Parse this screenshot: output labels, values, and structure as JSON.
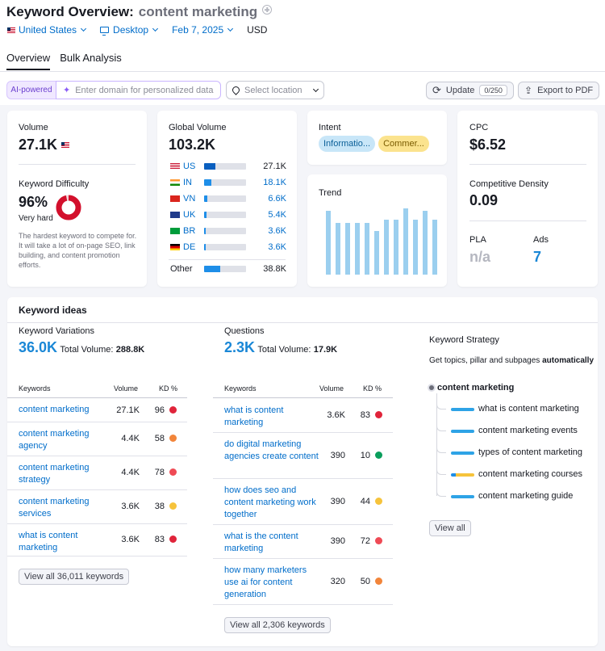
{
  "header": {
    "title_prefix": "Keyword Overview:",
    "keyword": "content marketing",
    "country": "United States",
    "device": "Desktop",
    "date": "Feb 7, 2025",
    "currency": "USD"
  },
  "tabs": [
    "Overview",
    "Bulk Analysis"
  ],
  "toolbar": {
    "ai_label": "AI-powered",
    "domain_placeholder": "Enter domain for personalized data",
    "location_placeholder": "Select location",
    "update_label": "Update",
    "update_badge": "0/250",
    "export_label": "Export to PDF"
  },
  "volume": {
    "label": "Volume",
    "value": "27.1K",
    "kd_label": "Keyword Difficulty",
    "kd_value": "96%",
    "kd_percent": 96,
    "kd_text": "Very hard",
    "kd_desc": "The hardest keyword to compete for. It will take a lot of on-page SEO, link building, and content promotion efforts."
  },
  "global": {
    "label": "Global Volume",
    "value": "103.2K",
    "rows": [
      {
        "code": "US",
        "value": "27.1K",
        "share": 0.26
      },
      {
        "code": "IN",
        "value": "18.1K",
        "share": 0.18
      },
      {
        "code": "VN",
        "value": "6.6K",
        "share": 0.07
      },
      {
        "code": "UK",
        "value": "5.4K",
        "share": 0.06
      },
      {
        "code": "BR",
        "value": "3.6K",
        "share": 0.04
      },
      {
        "code": "DE",
        "value": "3.6K",
        "share": 0.04
      }
    ],
    "other_label": "Other",
    "other_value": "38.8K",
    "other_share": 0.38
  },
  "intent": {
    "label": "Intent",
    "tags": [
      "Informatio...",
      "Commer..."
    ]
  },
  "trend": {
    "label": "Trend",
    "values": [
      0.96,
      0.78,
      0.78,
      0.78,
      0.78,
      0.66,
      0.83,
      0.83,
      1.0,
      0.83,
      0.96,
      0.83
    ]
  },
  "cpc": {
    "label": "CPC",
    "value": "$6.52",
    "cd_label": "Competitive Density",
    "cd_value": "0.09",
    "pla_label": "PLA",
    "pla_value": "n/a",
    "ads_label": "Ads",
    "ads_value": "7"
  },
  "ideas": {
    "title": "Keyword ideas",
    "variations": {
      "title": "Keyword Variations",
      "count": "36.0K",
      "total_label": "Total Volume:",
      "total_value": "288.8K",
      "col_kw": "Keywords",
      "col_vol": "Volume",
      "col_kd": "KD %",
      "rows": [
        {
          "kw": "content marketing",
          "vol": "27.1K",
          "kd": "96",
          "color": "#e0243a"
        },
        {
          "kw": "content marketing agency",
          "vol": "4.4K",
          "kd": "58",
          "color": "#f2853a"
        },
        {
          "kw": "content marketing strategy",
          "vol": "4.4K",
          "kd": "78",
          "color": "#ef4a55"
        },
        {
          "kw": "content marketing services",
          "vol": "3.6K",
          "kd": "38",
          "color": "#f6c33b"
        },
        {
          "kw": "what is content marketing",
          "vol": "3.6K",
          "kd": "83",
          "color": "#e0243a"
        }
      ],
      "view_all": "View all 36,011 keywords"
    },
    "questions": {
      "title": "Questions",
      "count": "2.3K",
      "total_label": "Total Volume:",
      "total_value": "17.9K",
      "col_kw": "Keywords",
      "col_vol": "Volume",
      "col_kd": "KD %",
      "rows": [
        {
          "kw": "what is content marketing",
          "vol": "3.6K",
          "kd": "83",
          "color": "#e0243a"
        },
        {
          "kw": "do digital marketing agencies create content",
          "vol": "390",
          "kd": "10",
          "color": "#0a9e5c"
        },
        {
          "kw": "how does seo and content marketing work together",
          "vol": "390",
          "kd": "44",
          "color": "#f6c33b"
        },
        {
          "kw": "what is the content marketing",
          "vol": "390",
          "kd": "72",
          "color": "#ef4a55"
        },
        {
          "kw": "how many marketers use ai for content generation",
          "vol": "320",
          "kd": "50",
          "color": "#f2853a"
        }
      ],
      "view_all": "View all 2,306 keywords"
    },
    "strategy": {
      "title": "Keyword Strategy",
      "desc": "Get topics, pillar and subpages",
      "desc_bold": "automatically",
      "pillar": "content marketing",
      "items": [
        "what is content marketing",
        "content marketing events",
        "types of content marketing",
        "content marketing courses",
        "content marketing guide"
      ],
      "view_all": "View all"
    }
  }
}
